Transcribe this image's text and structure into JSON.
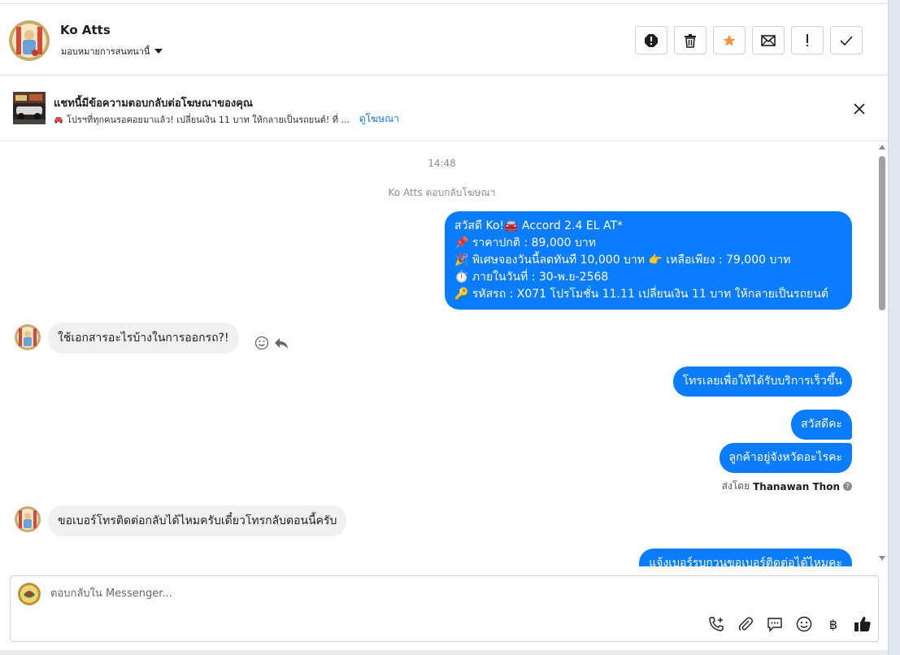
{
  "header": {
    "contact_name": "Ko Atts",
    "assign_label": "มอบหมายการสนทนานี้",
    "actions": [
      {
        "name": "report-icon",
        "label": "!"
      },
      {
        "name": "trash-icon",
        "label": ""
      },
      {
        "name": "star-icon",
        "label": "★"
      },
      {
        "name": "mail-icon",
        "label": ""
      },
      {
        "name": "follow-up-icon",
        "label": "!"
      },
      {
        "name": "check-icon",
        "label": "✓"
      }
    ],
    "colors": {
      "star": "#f5923e"
    }
  },
  "ad": {
    "title": "แชทนี้มีข้อความตอบกลับต่อโฆษณาของคุณ",
    "subtitle": "โปรฯที่ทุกคนรอคอยมาแล้ว! เปลี่ยนเงิน 11 บาท ให้กลายเป็นรถยนต์! ที่ ...",
    "link": "ดูโฆษณา"
  },
  "chat": {
    "timestamp": "14:48",
    "system_note": "Ko Atts ตอบกลับโฆษณา",
    "ad_message_lines": [
      "สวัสดี Ko!🚘 Accord 2.4 EL AT*",
      "📌 ราคาปกติ : 89,000 บาท",
      "🎉  พิเศษจองวันนี้ลดทันที 10,000 บาท 👉 เหลือเพียง : 79,000 บาท",
      "⏱️ ภายในวันที่ : 30-พ.ย-2568",
      "🔑 รหัสรถ : X071 โปรโมชั่น 11.11 เปลี่ยนเงิน 11 บาท ให้กลายเป็นรถยนต์"
    ],
    "incoming_1": "ใช้เอกสารอะไรบ้างในการออกรถ?!",
    "outgoing_1": "โทรเลยเพื่อให้ได้รับบริการเร็วขึ้น",
    "outgoing_2": "สวัสดีคะ",
    "outgoing_3": "ลูกค้าอยู่จังหวัดอะไรคะ",
    "sent_by_prefix": "ส่งโดย",
    "sent_by_name": "Thanawan Thon",
    "incoming_2": "ขอเบอร์โทรติดต่อกลับได้ไหมครับเดี๋ยวโทรกลับตอนนี้ครับ",
    "outgoing_4_partial": "แจ้งเบอร์รบกวนขอเบอร์ติดต่อได้ไหมคะ"
  },
  "composer": {
    "placeholder": "ตอบกลับใน Messenger...",
    "currency_symbol": "฿"
  },
  "colors": {
    "accent": "#0a7cff",
    "link": "#1877f2",
    "incoming_bubble": "#f0f0f0"
  }
}
